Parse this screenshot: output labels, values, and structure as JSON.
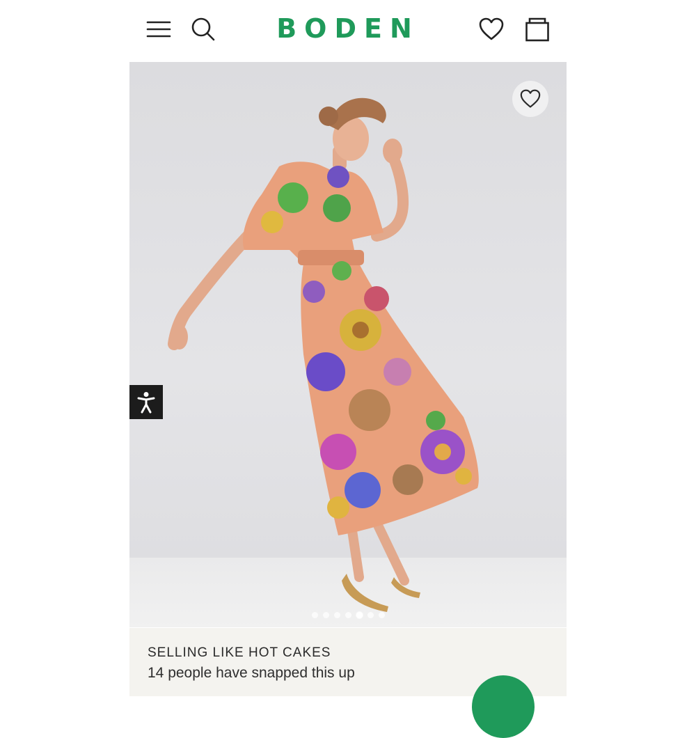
{
  "header": {
    "brand": "BODEN",
    "icons": {
      "menu": "hamburger-menu-icon",
      "search": "search-icon",
      "wishlist": "heart-icon",
      "bag": "shopping-bag-icon"
    }
  },
  "hero": {
    "wishlist_icon": "heart-outline-icon",
    "gallery": {
      "total": 7,
      "active_index": 4
    }
  },
  "accessibility": {
    "icon": "accessibility-person-icon"
  },
  "social_proof": {
    "title": "SELLING LIKE HOT CAKES",
    "subtitle": "14 people have snapped this up"
  },
  "colors": {
    "brand": "#1f9a5a",
    "text": "#2a2a2a",
    "info_bg": "#f4f3ef"
  }
}
